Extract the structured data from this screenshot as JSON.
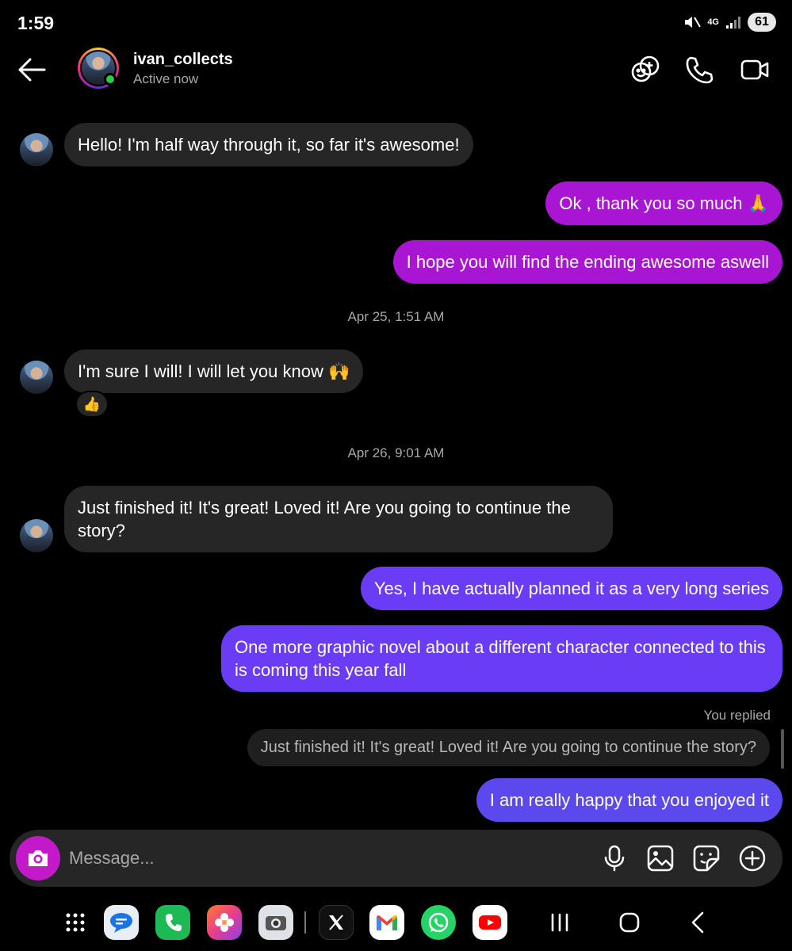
{
  "status_bar": {
    "time": "1:59",
    "network": "4G",
    "battery": "61",
    "icons": [
      "mute-icon",
      "signal-icon"
    ]
  },
  "header": {
    "contact_name": "ivan_collects",
    "contact_status": "Active now",
    "icons": [
      "back-arrow-icon",
      "add-people-icon",
      "phone-icon",
      "video-icon"
    ]
  },
  "messages": [
    {
      "side": "in",
      "text": "Hello! I'm half way through it, so far it's awesome!"
    },
    {
      "side": "out",
      "text": "Ok , thank you so much 🙏",
      "color": "#a815d3"
    },
    {
      "side": "out",
      "text": "I hope you will find the ending awesome aswell",
      "color": "#a815d3"
    },
    {
      "type": "timestamp",
      "text": "Apr 25, 1:51 AM"
    },
    {
      "side": "in",
      "text": "I'm sure I will! I will let you know 🙌",
      "reaction": "👍"
    },
    {
      "type": "timestamp",
      "text": "Apr 26, 9:01 AM"
    },
    {
      "side": "in",
      "text": "Just finished it! It's great! Loved it! Are you going to continue the story?"
    },
    {
      "side": "out",
      "text": "Yes, I have actually planned it as a very long series",
      "color": "#6b3cf5"
    },
    {
      "side": "out",
      "text": "One more graphic novel about a different character connected to this is coming this year fall",
      "color": "#6b3cf5"
    },
    {
      "type": "reply",
      "label": "You replied",
      "quote": "Just finished it! It's great! Loved it! Are you going to continue the story?"
    },
    {
      "side": "out",
      "text": "I am really happy that you enjoyed it",
      "color": "#5b49ee"
    }
  ],
  "composer": {
    "placeholder": "Message...",
    "icons": [
      "camera-icon",
      "microphone-icon",
      "gallery-icon",
      "sticker-icon",
      "plus-icon"
    ]
  },
  "nav_bar": {
    "apps": [
      "app-drawer-icon",
      "messages-app-icon",
      "phone-app-icon",
      "photos-app-icon",
      "camera-app-icon",
      "x-app-icon",
      "gmail-app-icon",
      "whatsapp-app-icon",
      "youtube-app-icon"
    ],
    "system_buttons": [
      "recents-icon",
      "home-icon",
      "back-icon"
    ]
  },
  "colors": {
    "background": "#000000",
    "incoming_bubble": "#262626",
    "outgoing_pink": "#a815d3",
    "outgoing_violet": "#6b3cf5",
    "outgoing_blue": "#5b49ee",
    "camera_button": "#c319c9",
    "online": "#2ecc40"
  }
}
